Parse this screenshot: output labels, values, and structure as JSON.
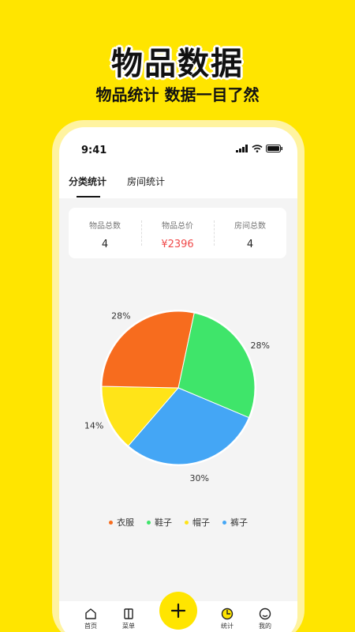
{
  "promo": {
    "title": "物品数据",
    "subtitle": "物品统计 数据一目了然"
  },
  "status_bar": {
    "time": "9:41"
  },
  "tabs": [
    {
      "label": "分类统计",
      "active": true
    },
    {
      "label": "房间统计",
      "active": false
    }
  ],
  "summary": [
    {
      "label": "物品总数",
      "value": "4"
    },
    {
      "label": "物品总价",
      "value": "¥2396"
    },
    {
      "label": "房间总数",
      "value": "4"
    }
  ],
  "chart_data": {
    "type": "pie",
    "categories": [
      "衣服",
      "鞋子",
      "帽子",
      "裤子"
    ],
    "values": [
      28,
      28,
      14,
      30
    ],
    "labels": [
      "28%",
      "28%",
      "14%",
      "30%"
    ],
    "colors": [
      "#F76C1E",
      "#3FE56A",
      "#FFE418",
      "#44A6F5"
    ],
    "legend": "bottom"
  },
  "bottom_nav": [
    {
      "label": "首页",
      "icon": "home-icon"
    },
    {
      "label": "菜单",
      "icon": "menu-icon"
    },
    {
      "label": "统计",
      "icon": "stats-icon"
    },
    {
      "label": "我的",
      "icon": "profile-icon"
    }
  ],
  "add_button": {
    "icon": "plus-icon"
  }
}
